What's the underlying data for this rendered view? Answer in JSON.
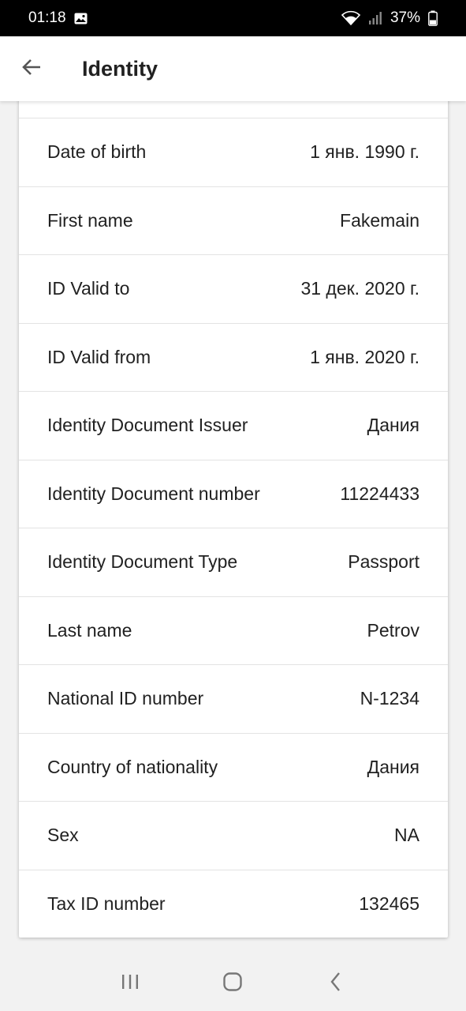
{
  "status_bar": {
    "time": "01:18",
    "battery": "37%"
  },
  "app_bar": {
    "title": "Identity"
  },
  "fields": [
    {
      "label": "Date of birth",
      "value": "1 янв. 1990 г."
    },
    {
      "label": "First name",
      "value": "Fakemain"
    },
    {
      "label": "ID Valid to",
      "value": "31 дек. 2020 г."
    },
    {
      "label": "ID Valid from",
      "value": "1 янв. 2020 г."
    },
    {
      "label": "Identity Document Issuer",
      "value": "Дания"
    },
    {
      "label": "Identity Document number",
      "value": "11224433"
    },
    {
      "label": "Identity Document Type",
      "value": "Passport"
    },
    {
      "label": "Last name",
      "value": "Petrov"
    },
    {
      "label": "National ID number",
      "value": "N-1234"
    },
    {
      "label": "Country of nationality",
      "value": "Дания"
    },
    {
      "label": "Sex",
      "value": "NA"
    },
    {
      "label": "Tax ID number",
      "value": "132465"
    }
  ],
  "icons": {
    "status_left": [
      "image-icon"
    ],
    "status_right": [
      "wifi-icon",
      "signal-icon",
      "battery-icon"
    ],
    "app_bar": [
      "back-arrow-icon"
    ],
    "nav_bar": [
      "recents-icon",
      "home-icon",
      "back-icon"
    ]
  }
}
